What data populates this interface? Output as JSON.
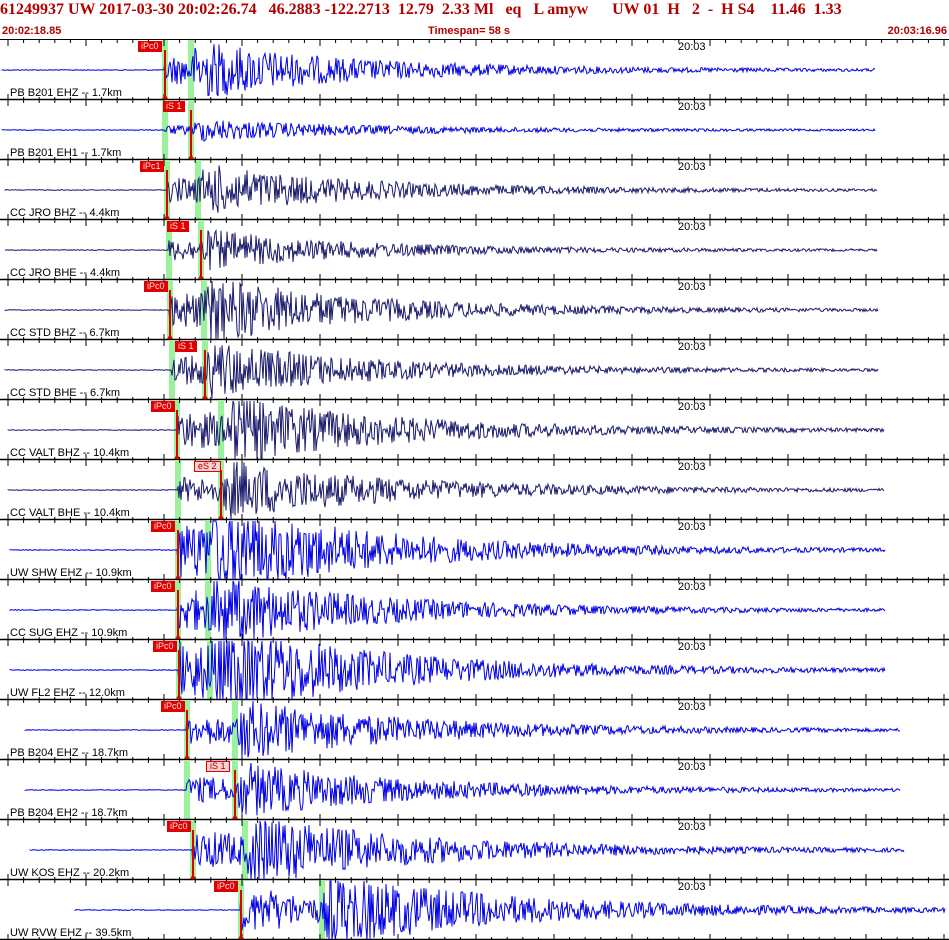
{
  "header": {
    "title": "61249937 UW 2017-03-30 20:02:26.74   46.2883 -122.2713  12.79  2.33 Ml   eq   L amyw      UW 01  H   2  -  H S4    11.46  1.33",
    "start_time": "20:02:18.85",
    "timespan": "Timespan=  58 s",
    "end_time": "20:03:16.96"
  },
  "colors": {
    "trace_bhz": "#1a1a6e",
    "trace_ehz": "#0000e6",
    "pick_red": "#e00000",
    "pick_green": "#9cf19c",
    "title_red": "#b00000"
  },
  "time_marker": "20:03",
  "channels": [
    {
      "label": "PB B201 EHZ -- 1.7km",
      "pick": "iPc0",
      "pick_style": "solid",
      "color": "ehz"
    },
    {
      "label": "PB B201 EH1 -- 1.7km",
      "pick": "iS 1",
      "pick_style": "solid",
      "color": "ehz"
    },
    {
      "label": "CC JRO BHZ -- 4.4km",
      "pick": "iPc1",
      "pick_style": "solid",
      "color": "bhz"
    },
    {
      "label": "CC JRO BHE -- 4.4km",
      "pick": "iS 1",
      "pick_style": "solid",
      "color": "bhz"
    },
    {
      "label": "CC STD BHZ -- 6.7km",
      "pick": "iPc0",
      "pick_style": "solid",
      "color": "bhz"
    },
    {
      "label": "CC STD BHE -- 6.7km",
      "pick": "iS 1",
      "pick_style": "solid",
      "color": "bhz"
    },
    {
      "label": "CC VALT BHZ -- 10.4km",
      "pick": "iPc0",
      "pick_style": "solid",
      "color": "bhz"
    },
    {
      "label": "CC VALT BHE -- 10.4km",
      "pick": "eS 2",
      "pick_style": "pale",
      "color": "bhz"
    },
    {
      "label": "UW SHW EHZ -- 10.9km",
      "pick": "iPc0",
      "pick_style": "solid",
      "color": "ehz"
    },
    {
      "label": "CC SUG EHZ -- 10.9km",
      "pick": "iPc0",
      "pick_style": "solid",
      "color": "ehz"
    },
    {
      "label": "UW FL2 EHZ -- 12.0km",
      "pick": "iPc0",
      "pick_style": "solid",
      "color": "ehz"
    },
    {
      "label": "PB B204 EHZ -- 18.7km",
      "pick": "iPc0",
      "pick_style": "solid",
      "color": "ehz"
    },
    {
      "label": "PB B204 EH2 -- 18.7km",
      "pick": "iS 1",
      "pick_style": "pale",
      "color": "ehz"
    },
    {
      "label": "UW KOS EHZ -- 20.2km",
      "pick": "iPc0",
      "pick_style": "solid",
      "color": "ehz"
    },
    {
      "label": "UW RVW EHZ -- 39.5km",
      "pick": "iPc0",
      "pick_style": "solid",
      "color": "ehz"
    }
  ]
}
